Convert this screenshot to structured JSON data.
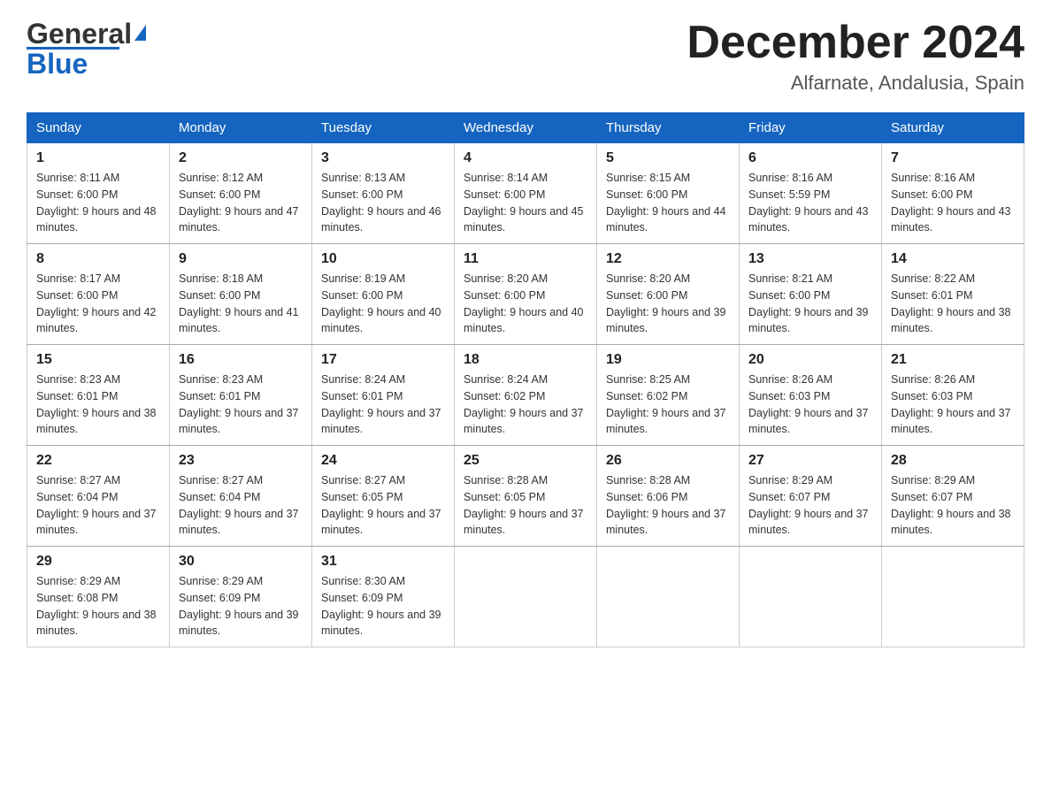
{
  "header": {
    "logo_general": "General",
    "logo_blue": "Blue",
    "month_title": "December 2024",
    "location": "Alfarnate, Andalusia, Spain"
  },
  "weekdays": [
    "Sunday",
    "Monday",
    "Tuesday",
    "Wednesday",
    "Thursday",
    "Friday",
    "Saturday"
  ],
  "weeks": [
    [
      {
        "day": "1",
        "sunrise": "8:11 AM",
        "sunset": "6:00 PM",
        "daylight": "9 hours and 48 minutes."
      },
      {
        "day": "2",
        "sunrise": "8:12 AM",
        "sunset": "6:00 PM",
        "daylight": "9 hours and 47 minutes."
      },
      {
        "day": "3",
        "sunrise": "8:13 AM",
        "sunset": "6:00 PM",
        "daylight": "9 hours and 46 minutes."
      },
      {
        "day": "4",
        "sunrise": "8:14 AM",
        "sunset": "6:00 PM",
        "daylight": "9 hours and 45 minutes."
      },
      {
        "day": "5",
        "sunrise": "8:15 AM",
        "sunset": "6:00 PM",
        "daylight": "9 hours and 44 minutes."
      },
      {
        "day": "6",
        "sunrise": "8:16 AM",
        "sunset": "5:59 PM",
        "daylight": "9 hours and 43 minutes."
      },
      {
        "day": "7",
        "sunrise": "8:16 AM",
        "sunset": "6:00 PM",
        "daylight": "9 hours and 43 minutes."
      }
    ],
    [
      {
        "day": "8",
        "sunrise": "8:17 AM",
        "sunset": "6:00 PM",
        "daylight": "9 hours and 42 minutes."
      },
      {
        "day": "9",
        "sunrise": "8:18 AM",
        "sunset": "6:00 PM",
        "daylight": "9 hours and 41 minutes."
      },
      {
        "day": "10",
        "sunrise": "8:19 AM",
        "sunset": "6:00 PM",
        "daylight": "9 hours and 40 minutes."
      },
      {
        "day": "11",
        "sunrise": "8:20 AM",
        "sunset": "6:00 PM",
        "daylight": "9 hours and 40 minutes."
      },
      {
        "day": "12",
        "sunrise": "8:20 AM",
        "sunset": "6:00 PM",
        "daylight": "9 hours and 39 minutes."
      },
      {
        "day": "13",
        "sunrise": "8:21 AM",
        "sunset": "6:00 PM",
        "daylight": "9 hours and 39 minutes."
      },
      {
        "day": "14",
        "sunrise": "8:22 AM",
        "sunset": "6:01 PM",
        "daylight": "9 hours and 38 minutes."
      }
    ],
    [
      {
        "day": "15",
        "sunrise": "8:23 AM",
        "sunset": "6:01 PM",
        "daylight": "9 hours and 38 minutes."
      },
      {
        "day": "16",
        "sunrise": "8:23 AM",
        "sunset": "6:01 PM",
        "daylight": "9 hours and 37 minutes."
      },
      {
        "day": "17",
        "sunrise": "8:24 AM",
        "sunset": "6:01 PM",
        "daylight": "9 hours and 37 minutes."
      },
      {
        "day": "18",
        "sunrise": "8:24 AM",
        "sunset": "6:02 PM",
        "daylight": "9 hours and 37 minutes."
      },
      {
        "day": "19",
        "sunrise": "8:25 AM",
        "sunset": "6:02 PM",
        "daylight": "9 hours and 37 minutes."
      },
      {
        "day": "20",
        "sunrise": "8:26 AM",
        "sunset": "6:03 PM",
        "daylight": "9 hours and 37 minutes."
      },
      {
        "day": "21",
        "sunrise": "8:26 AM",
        "sunset": "6:03 PM",
        "daylight": "9 hours and 37 minutes."
      }
    ],
    [
      {
        "day": "22",
        "sunrise": "8:27 AM",
        "sunset": "6:04 PM",
        "daylight": "9 hours and 37 minutes."
      },
      {
        "day": "23",
        "sunrise": "8:27 AM",
        "sunset": "6:04 PM",
        "daylight": "9 hours and 37 minutes."
      },
      {
        "day": "24",
        "sunrise": "8:27 AM",
        "sunset": "6:05 PM",
        "daylight": "9 hours and 37 minutes."
      },
      {
        "day": "25",
        "sunrise": "8:28 AM",
        "sunset": "6:05 PM",
        "daylight": "9 hours and 37 minutes."
      },
      {
        "day": "26",
        "sunrise": "8:28 AM",
        "sunset": "6:06 PM",
        "daylight": "9 hours and 37 minutes."
      },
      {
        "day": "27",
        "sunrise": "8:29 AM",
        "sunset": "6:07 PM",
        "daylight": "9 hours and 37 minutes."
      },
      {
        "day": "28",
        "sunrise": "8:29 AM",
        "sunset": "6:07 PM",
        "daylight": "9 hours and 38 minutes."
      }
    ],
    [
      {
        "day": "29",
        "sunrise": "8:29 AM",
        "sunset": "6:08 PM",
        "daylight": "9 hours and 38 minutes."
      },
      {
        "day": "30",
        "sunrise": "8:29 AM",
        "sunset": "6:09 PM",
        "daylight": "9 hours and 39 minutes."
      },
      {
        "day": "31",
        "sunrise": "8:30 AM",
        "sunset": "6:09 PM",
        "daylight": "9 hours and 39 minutes."
      },
      null,
      null,
      null,
      null
    ]
  ]
}
